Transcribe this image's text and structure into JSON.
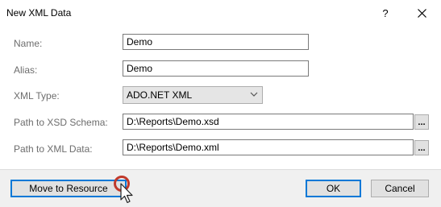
{
  "window": {
    "title": "New XML Data",
    "help_label": "?",
    "close_icon": "close-icon"
  },
  "form": {
    "name": {
      "label": "Name:",
      "value": "Demo"
    },
    "alias": {
      "label": "Alias:",
      "value": "Demo"
    },
    "xml_type": {
      "label": "XML Type:",
      "value": "ADO.NET XML"
    },
    "xsd_path": {
      "label": "Path to XSD Schema:",
      "value": "D:\\Reports\\Demo.xsd",
      "browse_label": "..."
    },
    "xml_path": {
      "label": "Path to XML Data:",
      "value": "D:\\Reports\\Demo.xml",
      "browse_label": "..."
    }
  },
  "footer": {
    "move_to_resource_label": "Move to Resource",
    "ok_label": "OK",
    "cancel_label": "Cancel"
  },
  "colors": {
    "label_gray": "#6d6d6d",
    "focus_blue": "#0078d7",
    "highlight_ring": "#c0392b"
  }
}
